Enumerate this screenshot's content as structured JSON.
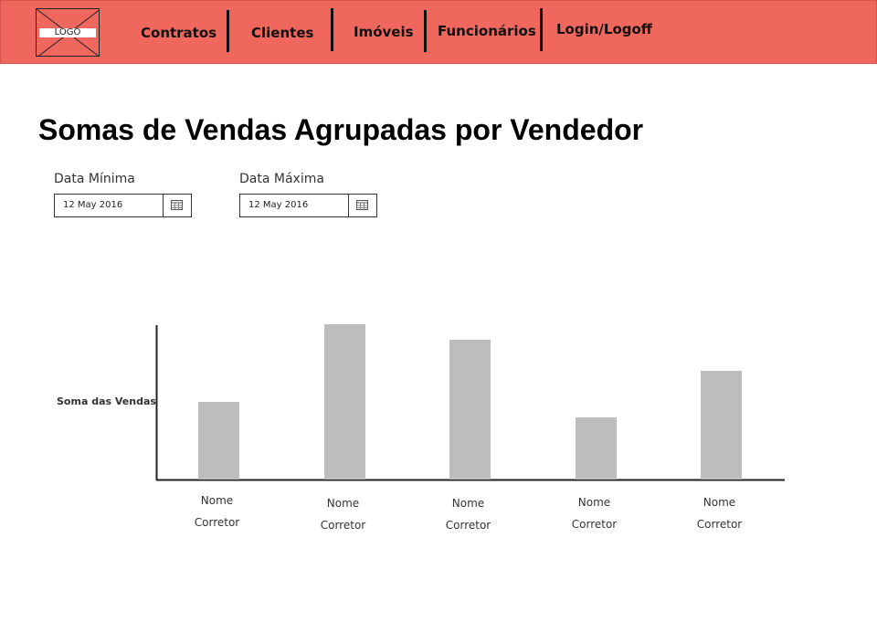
{
  "header": {
    "logo_text": "LOGO",
    "nav": [
      {
        "label": "Contratos"
      },
      {
        "label": "Clientes"
      },
      {
        "label": "Imóveis"
      },
      {
        "label": "Funcionários"
      },
      {
        "label": "Login/Logoff"
      }
    ],
    "background_color": "#f0685d"
  },
  "page": {
    "title": "Somas de Vendas Agrupadas por Vendedor"
  },
  "filters": {
    "min_date": {
      "label": "Data Mínima",
      "value": "12 May 2016"
    },
    "max_date": {
      "label": "Data Máxima",
      "value": "12 May 2016"
    }
  },
  "chart_data": {
    "type": "bar",
    "ylabel": "Soma das Vendas",
    "xlabel": "",
    "categories": [
      "Nome\nCorretor",
      "Nome\nCorretor",
      "Nome\nCorretor",
      "Nome\nCorretor",
      "Nome\nCorretor"
    ],
    "values": [
      50,
      100,
      90,
      40,
      70
    ],
    "ylim": [
      0,
      100
    ],
    "bar_color": "#bdbdbd",
    "grid": false
  }
}
